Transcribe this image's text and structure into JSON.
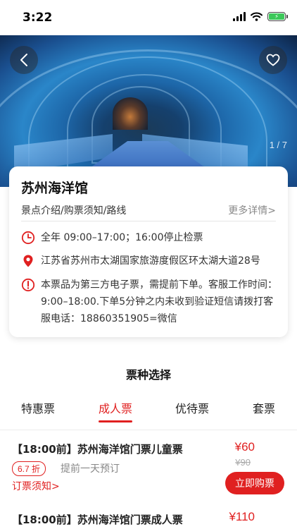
{
  "status_bar": {
    "time": "3:22"
  },
  "hero": {
    "pager": "1 / 7"
  },
  "venue": {
    "title": "苏州海洋馆",
    "links_label": "景点介绍/购票须知/路线",
    "more_details": "更多详情>",
    "hours": "全年 09:00–17:00；16:00停止检票",
    "address": "江苏省苏州市太湖国家旅游度假区环太湖大道28号",
    "notice": "本票品为第三方电子票，需提前下单。客服工作时间：9:00–18:00.下单5分钟之内未收到验证短信请拨打客服电话：18860351905=微信"
  },
  "tickets_section": {
    "title": "票种选择",
    "tabs": [
      {
        "label": "特惠票",
        "active": false
      },
      {
        "label": "成人票",
        "active": true
      },
      {
        "label": "优待票",
        "active": false
      },
      {
        "label": "套票",
        "active": false
      }
    ],
    "items": [
      {
        "name": "【18:00前】苏州海洋馆门票儿童票",
        "price": "¥60",
        "original_price": "¥90",
        "discount": "6.7 折",
        "booking_note": "提前一天预订",
        "notice_link": "订票须知>",
        "buy_label": "立即购票"
      },
      {
        "name": "【18:00前】苏州海洋馆门票成人票",
        "price": "¥110"
      }
    ]
  },
  "colors": {
    "accent": "#e02020",
    "battery": "#3cc85a"
  }
}
